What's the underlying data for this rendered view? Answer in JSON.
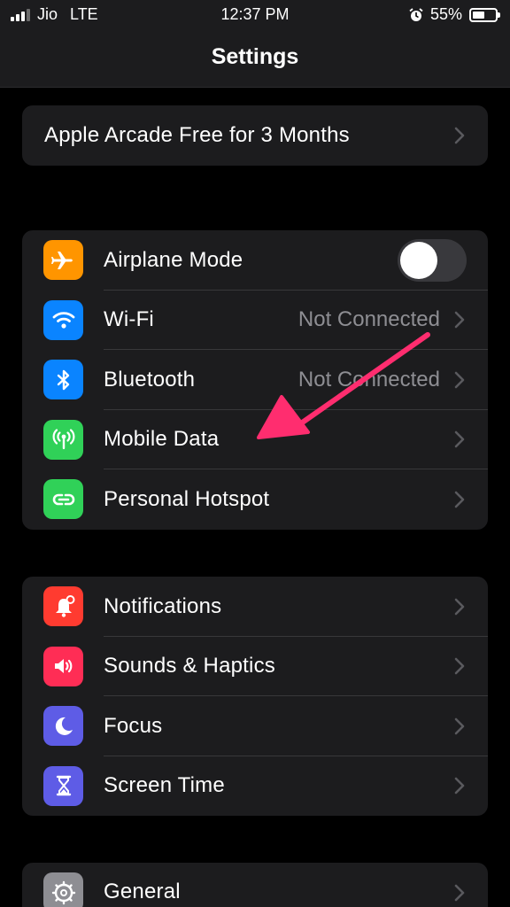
{
  "status_bar": {
    "carrier": "Jio",
    "network": "LTE",
    "time": "12:37 PM",
    "battery_percent": "55%",
    "battery_level": 0.55,
    "signal_bars": 3
  },
  "header": {
    "title": "Settings"
  },
  "promo": {
    "label": "Apple Arcade Free for 3 Months"
  },
  "connectivity": {
    "airplane_mode": {
      "label": "Airplane Mode",
      "on": false,
      "icon": "airplane-icon",
      "color": "#ff9500"
    },
    "wifi": {
      "label": "Wi-Fi",
      "value": "Not Connected",
      "icon": "wifi-icon",
      "color": "#0a84ff"
    },
    "bluetooth": {
      "label": "Bluetooth",
      "value": "Not Connected",
      "icon": "bluetooth-icon",
      "color": "#0a84ff"
    },
    "mobile_data": {
      "label": "Mobile Data",
      "icon": "antenna-icon",
      "color": "#30d158"
    },
    "hotspot": {
      "label": "Personal Hotspot",
      "icon": "link-icon",
      "color": "#30d158"
    }
  },
  "notifications_group": {
    "notifications": {
      "label": "Notifications",
      "icon": "notification-bell-icon",
      "color": "#ff3b30"
    },
    "sounds": {
      "label": "Sounds & Haptics",
      "icon": "speaker-icon",
      "color": "#ff2d55"
    },
    "focus": {
      "label": "Focus",
      "icon": "moon-icon",
      "color": "#5e5ce6"
    },
    "screen_time": {
      "label": "Screen Time",
      "icon": "hourglass-icon",
      "color": "#5e5ce6"
    }
  },
  "general_group": {
    "general": {
      "label": "General",
      "icon": "gear-icon",
      "color": "#8e8e93"
    }
  },
  "annotation": {
    "type": "arrow",
    "color": "#ff2d6f",
    "target": "Mobile Data"
  }
}
